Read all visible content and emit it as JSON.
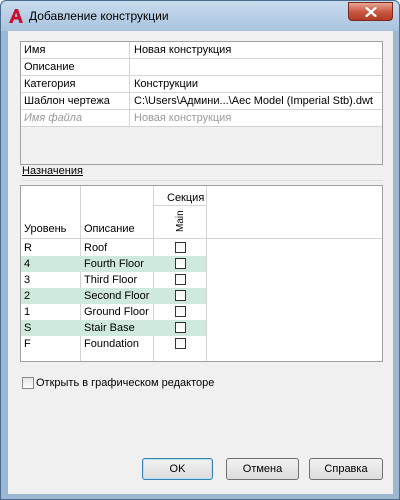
{
  "window": {
    "title": "Добавление конструкции"
  },
  "properties": [
    {
      "name": "Имя",
      "value": "Новая конструкция",
      "disabled": false
    },
    {
      "name": "Описание",
      "value": "",
      "disabled": false
    },
    {
      "name": "Категория",
      "value": "Конструкции",
      "disabled": false
    },
    {
      "name": "Шаблон чертежа",
      "value": "C:\\Users\\Админи...\\Aec Model (Imperial Stb).dwt",
      "disabled": false
    },
    {
      "name": "Имя файла",
      "value": "Новая конструкция",
      "disabled": true
    }
  ],
  "assignments": {
    "section_label": "Назначения",
    "columns": {
      "level": "Уровень",
      "description": "Описание",
      "section_group": "Секция",
      "section_main": "Main"
    },
    "rows": [
      {
        "level": "R",
        "description": "Roof",
        "highlighted": false,
        "checked": false
      },
      {
        "level": "4",
        "description": "Fourth Floor",
        "highlighted": true,
        "checked": false
      },
      {
        "level": "3",
        "description": "Third Floor",
        "highlighted": false,
        "checked": false
      },
      {
        "level": "2",
        "description": "Second Floor",
        "highlighted": true,
        "checked": false
      },
      {
        "level": "1",
        "description": "Ground Floor",
        "highlighted": false,
        "checked": false
      },
      {
        "level": "S",
        "description": "Stair Base",
        "highlighted": true,
        "checked": false
      },
      {
        "level": "F",
        "description": "Foundation",
        "highlighted": false,
        "checked": false
      }
    ]
  },
  "open_in_editor": {
    "label": "Открыть в графическом редакторе",
    "checked": false
  },
  "buttons": {
    "ok": "OK",
    "cancel": "Отмена",
    "help": "Справка"
  },
  "colors": {
    "row_highlight": "#cfe9dc",
    "title_bar": "#b9cfe6",
    "close_button": "#c7553e",
    "app_icon": "#c8102e"
  },
  "icons": {
    "app": "autocad-a-icon",
    "close": "close-icon"
  }
}
